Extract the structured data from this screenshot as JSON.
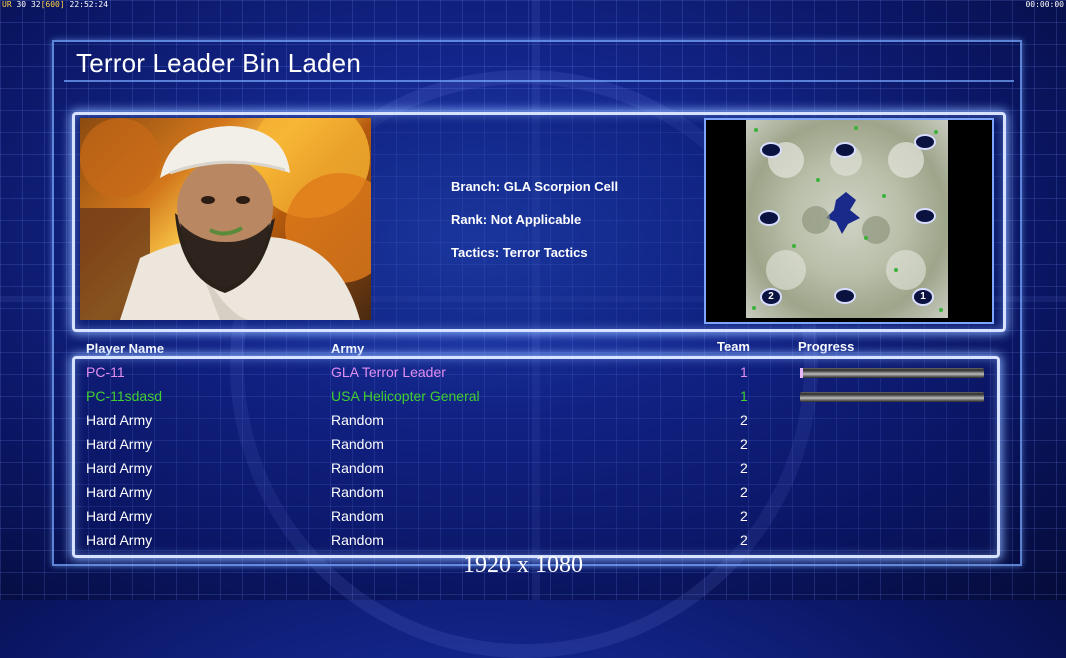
{
  "debug": {
    "left_prefix": "UR",
    "left_fps": "30",
    "left_val": "32",
    "left_bracket": "[600]",
    "left_time": "22:52:24",
    "right_time": "00:00:00"
  },
  "title": "Terror Leader Bin Laden",
  "general": {
    "branch": "Branch: GLA Scorpion Cell",
    "rank": "Rank: Not Applicable",
    "tactics": "Tactics: Terror Tactics"
  },
  "minimap": {
    "slot_labels": [
      "2",
      "1"
    ]
  },
  "columns": {
    "player": "Player Name",
    "army": "Army",
    "team": "Team",
    "progress": "Progress"
  },
  "players": [
    {
      "name": "PC-11",
      "army": "GLA Terror Leader",
      "team": "1",
      "color": "#e38ef0",
      "progress": 0.01
    },
    {
      "name": "PC-11sdasd",
      "army": "USA Helicopter General",
      "team": "1",
      "color": "#40d030",
      "progress": 0.0
    },
    {
      "name": "Hard Army",
      "army": "Random",
      "team": "2",
      "color": "#ffffff"
    },
    {
      "name": "Hard Army",
      "army": "Random",
      "team": "2",
      "color": "#ffffff"
    },
    {
      "name": "Hard Army",
      "army": "Random",
      "team": "2",
      "color": "#ffffff"
    },
    {
      "name": "Hard Army",
      "army": "Random",
      "team": "2",
      "color": "#ffffff"
    },
    {
      "name": "Hard Army",
      "army": "Random",
      "team": "2",
      "color": "#ffffff"
    },
    {
      "name": "Hard Army",
      "army": "Random",
      "team": "2",
      "color": "#ffffff"
    }
  ],
  "resolution": "1920 x 1080"
}
